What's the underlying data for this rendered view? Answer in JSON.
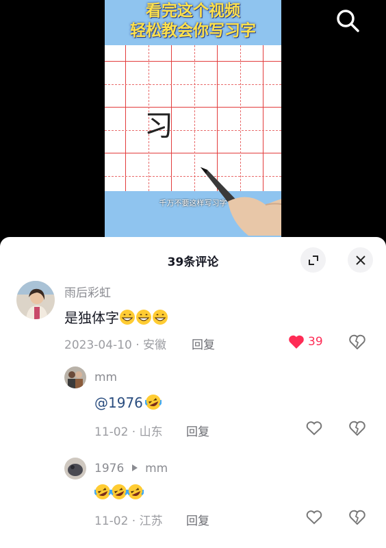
{
  "video": {
    "title_line1": "看完这个视频",
    "title_line2": "轻松教会你写习字",
    "written_char": "习",
    "subtitle": "千万不要这样写习字"
  },
  "comments_panel": {
    "title": "39条评论"
  },
  "comments": [
    {
      "user": "雨后彩虹",
      "text": "是独体字",
      "emoji": [
        "grin",
        "grin",
        "grin"
      ],
      "date": "2023-04-10 · 安徽",
      "reply_label": "回复",
      "likes": "39",
      "liked": true
    },
    {
      "user": "mm",
      "text": "@1976",
      "emoji": [
        "rofl"
      ],
      "date": "11-02 · 山东",
      "reply_label": "回复"
    },
    {
      "user": "1976",
      "reply_to": "mm",
      "text": "",
      "emoji": [
        "rofl",
        "rofl",
        "rofl"
      ],
      "date": "11-02 · 江苏",
      "reply_label": "回复"
    }
  ],
  "colors": {
    "accent": "#fe2c55",
    "mention": "#2a4d7f",
    "grid": "#e23b3b",
    "banner": "#8fc4ef"
  }
}
